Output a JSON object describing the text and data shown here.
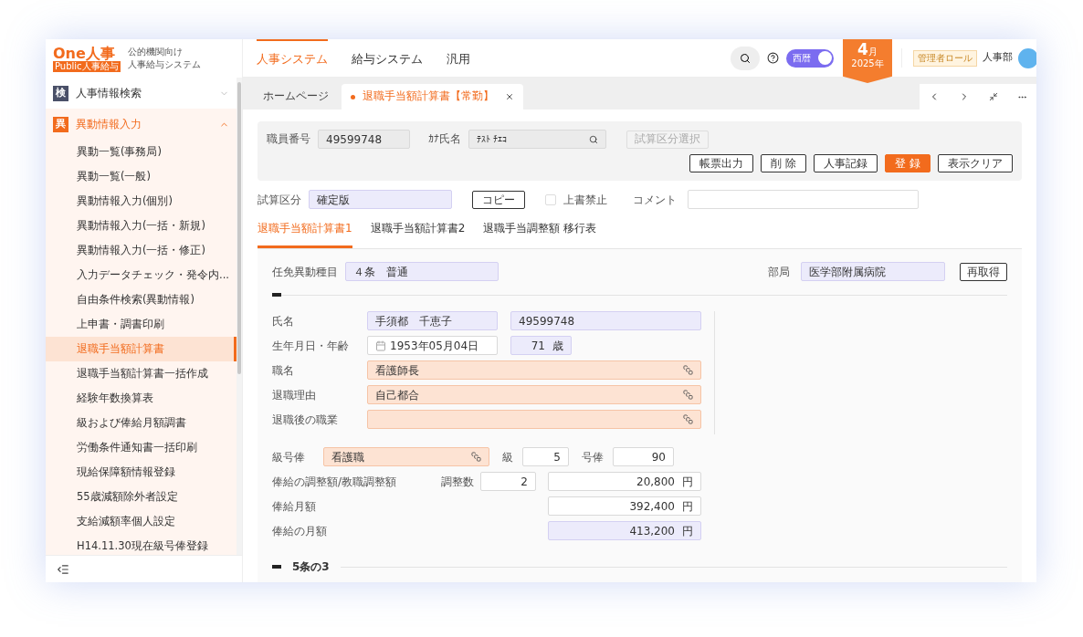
{
  "brand": {
    "logo": "One人事",
    "badge": "Public人事給与",
    "subtitle_1": "公的機関向け",
    "subtitle_2": "人事給与システム"
  },
  "sidebar": {
    "groups": [
      {
        "icon_char": "検",
        "label": "人事情報検索",
        "expanded": false
      },
      {
        "icon_char": "異",
        "label": "異動情報入力",
        "expanded": true,
        "children": [
          {
            "label": "異動一覧(事務局)",
            "selected": false
          },
          {
            "label": "異動一覧(一般)",
            "selected": false
          },
          {
            "label": "異動情報入力(個別)",
            "selected": false
          },
          {
            "label": "異動情報入力(一括・新規)",
            "selected": false
          },
          {
            "label": "異動情報入力(一括・修正)",
            "selected": false
          },
          {
            "label": "入力データチェック・発令内...",
            "selected": false
          },
          {
            "label": "自由条件検索(異動情報)",
            "selected": false
          },
          {
            "label": "上申書・調書印刷",
            "selected": false
          },
          {
            "label": "退職手当額計算書",
            "selected": true
          },
          {
            "label": "退職手当額計算書一括作成",
            "selected": false
          },
          {
            "label": "経験年数換算表",
            "selected": false
          },
          {
            "label": "級および俸給月額調書",
            "selected": false
          },
          {
            "label": "労働条件通知書一括印刷",
            "selected": false
          },
          {
            "label": "現給保障額情報登録",
            "selected": false
          },
          {
            "label": "55歳減額除外者設定",
            "selected": false
          },
          {
            "label": "支給減額率個人設定",
            "selected": false
          },
          {
            "label": "H14.11.30現在級号俸登録",
            "selected": false
          }
        ]
      }
    ]
  },
  "top_nav": [
    {
      "label": "人事システム",
      "selected": true
    },
    {
      "label": "給与システム",
      "selected": false
    },
    {
      "label": "汎用",
      "selected": false
    }
  ],
  "header": {
    "toggle": {
      "label": "西暦",
      "on": true
    },
    "month": "4",
    "month_unit": "月",
    "year": "2025年",
    "role": "管理者ロール",
    "department": "人事部"
  },
  "page_tabs": [
    {
      "label": "ホームページ",
      "selected": false,
      "closable": false
    },
    {
      "label": "退職手当額計算書【常勤】",
      "selected": true,
      "closable": true
    }
  ],
  "search_panel": {
    "employee_no_label": "職員番号",
    "employee_no": "49599748",
    "kana_label": "ｶﾅ氏名",
    "kana": "ﾃｽﾄ ﾁｴｺ",
    "select_button": "試算区分選択",
    "buttons": [
      {
        "label": "帳票出力",
        "primary": false
      },
      {
        "label": "削 除",
        "primary": false
      },
      {
        "label": "人事記録",
        "primary": false
      },
      {
        "label": "登 録",
        "primary": true
      },
      {
        "label": "表示クリア",
        "primary": false
      }
    ]
  },
  "calc_row": {
    "label": "試算区分",
    "value": "確定版",
    "copy_button": "コピー",
    "overwrite_lock": {
      "label": "上書禁止",
      "checked": false
    },
    "comment_label": "コメント"
  },
  "sub_tabs": [
    {
      "label": "退職手当額計算書1",
      "selected": true
    },
    {
      "label": "退職手当額計算書2",
      "selected": false
    },
    {
      "label": "退職手当調整額 移行表",
      "selected": false
    }
  ],
  "form": {
    "transfer_type_label": "任免異動種目",
    "transfer_type": "４条　普通",
    "department_label": "部局",
    "department": "医学部附属病院",
    "refetch_button": "再取得",
    "name_label": "氏名",
    "name": "手須都　千恵子",
    "name_no": "49599748",
    "birth_label": "生年月日・年齢",
    "birth": "1953年05月04日",
    "age": "71",
    "age_unit": "歳",
    "lookups": [
      {
        "label": "職名",
        "value": "看護師長"
      },
      {
        "label": "退職理由",
        "value": "自己都合"
      },
      {
        "label": "退職後の職業"
      }
    ],
    "grade_label": "級号俸",
    "grade_type": "看護職",
    "grade_level_label": "級",
    "grade_level": "5",
    "step_label": "号俸",
    "step": "90",
    "amounts": [
      {
        "label": "俸給の調整額/教職調整額",
        "count_label": "調整数",
        "count": "2",
        "value": "20,800",
        "unit": "円",
        "kind": "plain"
      },
      {
        "label": "俸給月額",
        "value": "392,400",
        "unit": "円",
        "kind": "plain"
      },
      {
        "label": "俸給の月額",
        "value": "413,200",
        "unit": "円",
        "kind": "readonly"
      }
    ],
    "section_title": "5条の3"
  }
}
